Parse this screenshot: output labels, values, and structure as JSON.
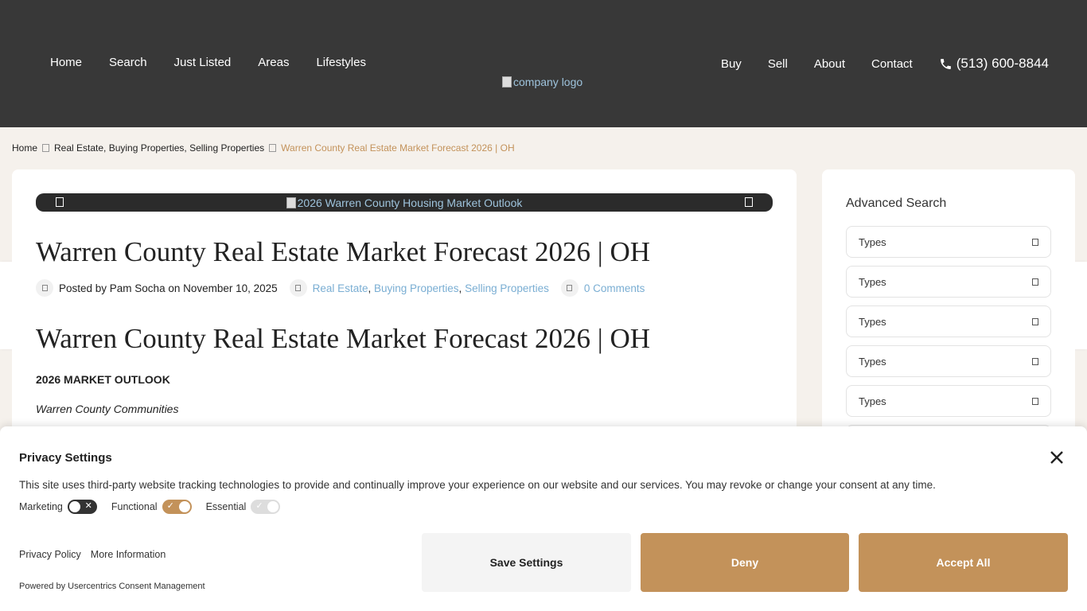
{
  "header": {
    "nav_left": [
      "Home",
      "Search",
      "Just Listed",
      "Areas",
      "Lifestyles"
    ],
    "nav_right": [
      "Buy",
      "Sell",
      "About",
      "Contact"
    ],
    "phone": "(513) 600-8844",
    "logo_alt": "company logo"
  },
  "breadcrumb": {
    "home": "Home",
    "categories": "Real Estate, Buying Properties, Selling Properties",
    "current": "Warren County Real Estate Market Forecast 2026 | OH"
  },
  "post": {
    "image_alt": "2026 Warren County Housing Market Outlook",
    "title": "Warren County Real Estate Market Forecast 2026 | OH",
    "posted_by": "Posted by Pam Socha on November 10, 2025",
    "categories": [
      "Real Estate",
      "Buying Properties",
      "Selling Properties"
    ],
    "comments": "0 Comments",
    "heading": "Warren County Real Estate Market Forecast 2026 | OH",
    "outlook": "2026 MARKET OUTLOOK",
    "communities": "Warren County Communities"
  },
  "sidebar": {
    "title": "Advanced Search",
    "selects": [
      "Types",
      "Types",
      "Types",
      "Types",
      "Types"
    ]
  },
  "consent": {
    "title": "Privacy Settings",
    "description": "This site uses third-party website tracking technologies to provide and continually improve your experience on our website and our services. You may revoke or change your consent at any time.",
    "toggles": {
      "marketing": "Marketing",
      "functional": "Functional",
      "essential": "Essential"
    },
    "privacy_policy": "Privacy Policy",
    "more_info": "More Information",
    "powered_by": "Powered by Usercentrics Consent Management",
    "save": "Save Settings",
    "deny": "Deny",
    "accept": "Accept All",
    "accent_color": "#c3925a"
  }
}
